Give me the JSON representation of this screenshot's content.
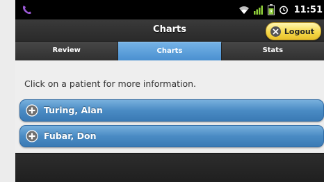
{
  "status_bar": {
    "time": "11:51",
    "left_icon": "viber-icon",
    "right_icons": [
      "wifi-icon",
      "signal-icon",
      "battery-icon",
      "alarm-icon"
    ]
  },
  "header": {
    "title": "Charts",
    "logout_label": "Logout"
  },
  "tabs": [
    {
      "label": "Review",
      "active": false
    },
    {
      "label": "Charts",
      "active": true
    },
    {
      "label": "Stats",
      "active": false
    }
  ],
  "content": {
    "instruction": "Click on a patient for more information.",
    "patients": [
      {
        "name": "Turing, Alan"
      },
      {
        "name": "Fubar, Don"
      }
    ]
  },
  "colors": {
    "accent_tab": "#5a9fdc",
    "patient_bar": "#4a8bc4",
    "logout_button": "#f6d84a"
  }
}
